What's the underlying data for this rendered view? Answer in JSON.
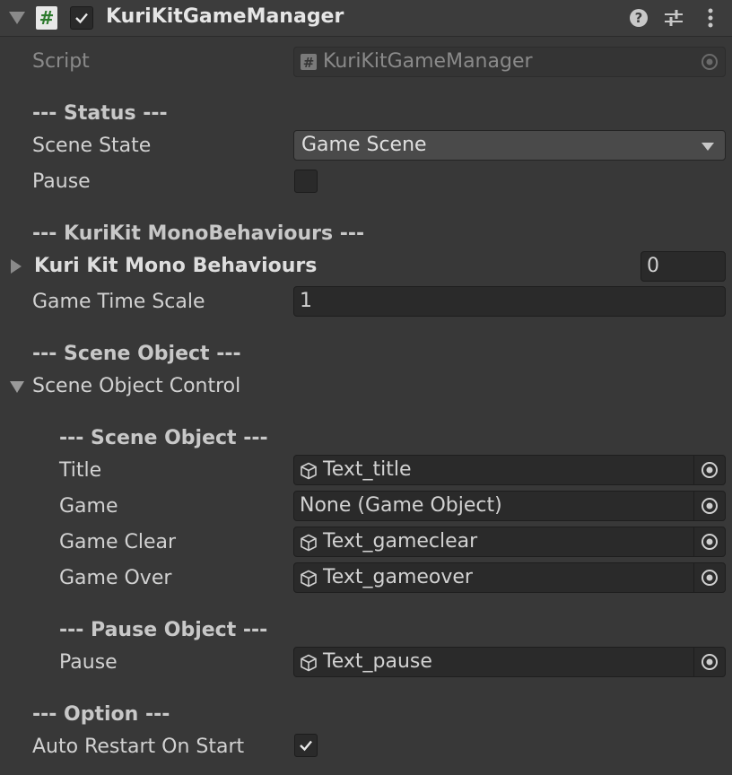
{
  "header": {
    "title": "KuriKitGameManager",
    "script_icon": "#",
    "enabled": true,
    "icons": [
      "help-icon",
      "settings-sliders-icon",
      "more-vert-icon"
    ]
  },
  "script_row": {
    "label": "Script",
    "value": "KuriKitGameManager"
  },
  "status_section": {
    "header": "--- Status ---",
    "scene_state": {
      "label": "Scene State",
      "value": "Game Scene"
    },
    "pause": {
      "label": "Pause",
      "checked": false
    }
  },
  "monobehaviours_section": {
    "header": "--- KuriKit MonoBehaviours ---",
    "list": {
      "label": "Kuri Kit Mono Behaviours",
      "size": "0"
    },
    "game_time_scale": {
      "label": "Game Time Scale",
      "value": "1"
    }
  },
  "scene_object_section": {
    "header": "--- Scene Object ---",
    "foldout": {
      "label": "Scene Object Control",
      "expanded": true
    },
    "inner_header": "--- Scene Object ---",
    "fields": [
      {
        "label": "Title",
        "value": "Text_title",
        "has_icon": true
      },
      {
        "label": "Game",
        "value": "None (Game Object)",
        "has_icon": false
      },
      {
        "label": "Game Clear",
        "value": "Text_gameclear",
        "has_icon": true
      },
      {
        "label": "Game Over",
        "value": "Text_gameover",
        "has_icon": true
      }
    ],
    "pause_header": "--- Pause Object ---",
    "pause_field": {
      "label": "Pause",
      "value": "Text_pause",
      "has_icon": true
    }
  },
  "option_section": {
    "header": "--- Option ---",
    "auto_restart": {
      "label": "Auto Restart On Start",
      "checked": true
    }
  }
}
